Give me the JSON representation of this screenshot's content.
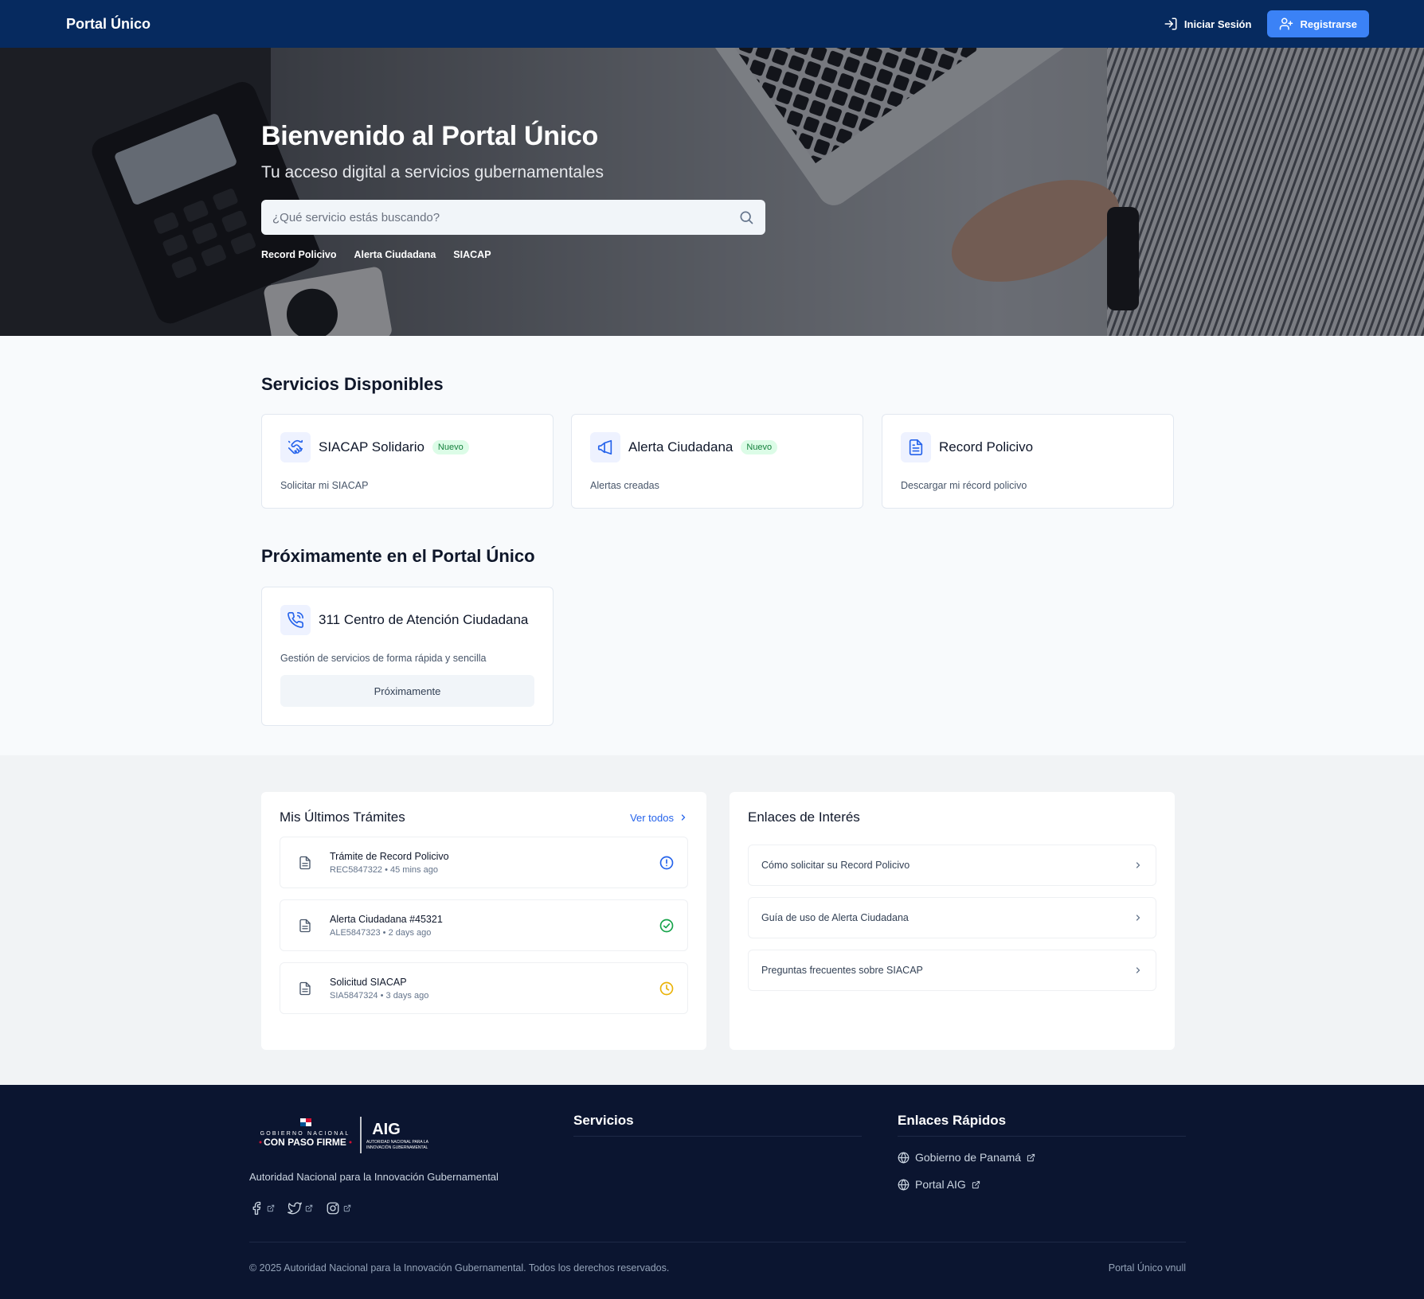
{
  "header": {
    "brand": "Portal Único",
    "login_label": "Iniciar Sesión",
    "register_label": "Registrarse"
  },
  "hero": {
    "title": "Bienvenido al Portal Único",
    "subtitle": "Tu acceso digital a servicios gubernamentales",
    "search_placeholder": "¿Qué servicio estás buscando?",
    "quick_links": [
      "Record Policivo",
      "Alerta Ciudadana",
      "SIACAP"
    ]
  },
  "services": {
    "title": "Servicios Disponibles",
    "items": [
      {
        "name": "SIACAP Solidario",
        "badge": "Nuevo",
        "desc": "Solicitar mi SIACAP",
        "icon": "handshake-icon"
      },
      {
        "name": "Alerta Ciudadana",
        "badge": "Nuevo",
        "desc": "Alertas creadas",
        "icon": "megaphone-icon"
      },
      {
        "name": "Record Policivo",
        "badge": "",
        "desc": "Descargar mi récord policivo",
        "icon": "document-icon"
      }
    ]
  },
  "upcoming": {
    "title": "Próximamente en el Portal Único",
    "item": {
      "name": "311 Centro de Atención Ciudadana",
      "desc": "Gestión de servicios de forma rápida y sencilla",
      "button": "Próximamente",
      "icon": "phone-icon"
    }
  },
  "tramites": {
    "title": "Mis Últimos Trámites",
    "see_all": "Ver todos",
    "items": [
      {
        "title": "Trámite de Record Policivo",
        "meta": "REC5847322 • 45 mins ago",
        "status_icon": "alert-circle-icon",
        "status_color": "#2563eb"
      },
      {
        "title": "Alerta Ciudadana #45321",
        "meta": "ALE5847323 • 2 days ago",
        "status_icon": "check-circle-icon",
        "status_color": "#16a34a"
      },
      {
        "title": "Solicitud SIACAP",
        "meta": "SIA5847324 • 3 days ago",
        "status_icon": "clock-icon",
        "status_color": "#eab308"
      }
    ]
  },
  "links": {
    "title": "Enlaces de Interés",
    "items": [
      "Cómo solicitar su Record Policivo",
      "Guía de uso de Alerta Ciudadana",
      "Preguntas frecuentes sobre SIACAP"
    ]
  },
  "footer": {
    "logo_left_top": "GOBIERNO NACIONAL",
    "logo_left_main": "CON PASO FIRME",
    "logo_right_main": "AIG",
    "logo_right_sub1": "AUTORIDAD NACIONAL PARA LA",
    "logo_right_sub2": "INNOVACIÓN GUBERNAMENTAL",
    "org_name": "Autoridad Nacional para la Innovación Gubernamental",
    "services_title": "Servicios",
    "quick_title": "Enlaces Rápidos",
    "quick_links": [
      "Gobierno de Panamá",
      "Portal AIG"
    ],
    "copyright": "© 2025 Autoridad Nacional para la Innovación Gubernamental. Todos los derechos reservados.",
    "version": "Portal Único vnull"
  },
  "colors": {
    "navy": "#062a5f",
    "accent": "#3b82f6",
    "footer_bg": "#0b1530",
    "badge_bg": "#dcfce7"
  }
}
